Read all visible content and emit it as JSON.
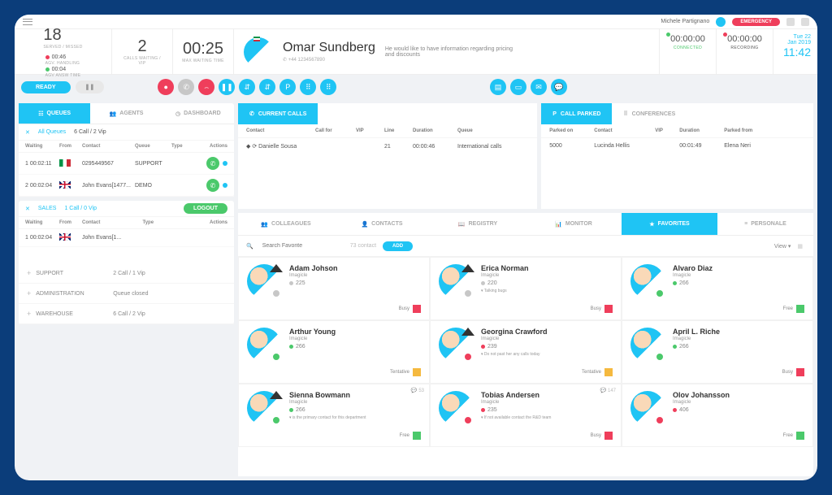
{
  "topbar": {
    "user": "Michele Partignano",
    "emergency": "EMERGENCY"
  },
  "stats": {
    "served": "18",
    "served_label": "SERVED / MISSED",
    "t1": "00:46",
    "t1l": "AGV. HANDLING",
    "t2": "00:04",
    "t2l": "AGV ANSW TIME",
    "calls": "2",
    "calls_label": "CALLS WAITING / VIP",
    "maxwait": "00:25",
    "maxwait_label": "MAX WAITING TIME"
  },
  "caller": {
    "name": "Omar Sundberg",
    "phone": "+44 1234567890",
    "desc": "He would like to have information regarding pricing and discounts"
  },
  "timers": {
    "connected": "00:00:00",
    "connected_l": "CONNECTED",
    "recording": "00:00:00",
    "recording_l": "RECORDING"
  },
  "date": {
    "day": "Tue 22",
    "month": "Jan 2019",
    "time": "11:42"
  },
  "ready": "READY",
  "ltabs": [
    "QUEUES",
    "AGENTS",
    "DASHBOARD"
  ],
  "allq": "All Queues",
  "qstat": "6 Call / 2 Vip",
  "qh": {
    "w": "Waiting",
    "f": "From",
    "c": "Contact",
    "q": "Queue",
    "t": "Type",
    "a": "Actions"
  },
  "qrows": [
    {
      "i": "1",
      "w": "00:02:11",
      "flag": "it",
      "c": "0295449567",
      "q": "SUPPORT"
    },
    {
      "i": "2",
      "w": "00:02:04",
      "flag": "uk",
      "c": "John Evans[1477...",
      "q": "DEMO"
    }
  ],
  "sales": {
    "name": "SALES",
    "stat": "1 Call / 0 Vip",
    "logout": "LOGOUT"
  },
  "sh": {
    "w": "Waiting",
    "f": "From",
    "c": "Contact",
    "t": "Type",
    "a": "Actions"
  },
  "srows": [
    {
      "i": "1",
      "w": "00:02:04",
      "flag": "uk",
      "c": "John Evans[1..."
    }
  ],
  "queues": [
    {
      "n": "SUPPORT",
      "s": "2 Call / 1 Vip"
    },
    {
      "n": "ADMINISTRATION",
      "s": "Queue closed"
    },
    {
      "n": "WAREHOUSE",
      "s": "6 Call / 2 Vip"
    }
  ],
  "cc": {
    "title": "CURRENT CALLS",
    "h": {
      "c": "Contact",
      "cf": "Call for",
      "v": "VIP",
      "l": "Line",
      "d": "Duration",
      "q": "Queue"
    },
    "r": {
      "c": "Danielle Sousa",
      "l": "21",
      "d": "00:00:46",
      "q": "International calls"
    }
  },
  "cp": {
    "title": "CALL PARKED",
    "alt": "CONFERENCES",
    "h": {
      "p": "Parked on",
      "c": "Contact",
      "v": "VIP",
      "d": "Duration",
      "pf": "Parked from"
    },
    "r": {
      "p": "5000",
      "c": "Lucinda Hellis",
      "d": "00:01:49",
      "pf": "Elena Neri"
    }
  },
  "btabs": [
    "COLLEAGUES",
    "CONTACTS",
    "REGISTRY",
    "MONITOR",
    "FAVORITES",
    "PERSONALE"
  ],
  "search": {
    "ph": "Search Favorite",
    "count": "73 contact",
    "add": "ADD",
    "view": "View"
  },
  "cards": [
    {
      "n": "Adam Johson",
      "co": "Imagicle",
      "ext": "225",
      "dot": "gray",
      "st": "Busy",
      "sq": "#ef3e5b",
      "tri": "#333"
    },
    {
      "n": "Erica Norman",
      "co": "Imagicle",
      "ext": "220",
      "dot": "gray",
      "note": "▾ Talking bugs",
      "st": "Busy",
      "sq": "#ef3e5b",
      "tri": "#333"
    },
    {
      "n": "Alvaro Diaz",
      "co": "Imagicle",
      "ext": "266",
      "dot": "green",
      "st": "Free",
      "sq": "#4bc96b"
    },
    {
      "n": "Arthur Young",
      "co": "Imagicle",
      "ext": "266",
      "dot": "green",
      "st": "Tentative",
      "sq": "#f5b93f"
    },
    {
      "n": "Georgina Crawford",
      "co": "Imagicle",
      "ext": "239",
      "dot": "red",
      "note": "▾ Do not past her any calls today",
      "st": "Tentative",
      "sq": "#f5b93f",
      "tri": "#333"
    },
    {
      "n": "April L. Riche",
      "co": "Imagicle",
      "ext": "266",
      "dot": "green",
      "st": "Busy",
      "sq": "#ef3e5b"
    },
    {
      "n": "Sienna Bowmann",
      "co": "Imagicle",
      "ext": "266",
      "dot": "green",
      "note": "▾ is the primary contact for this department",
      "st": "Free",
      "sq": "#4bc96b",
      "tri": "#333",
      "corner": "53"
    },
    {
      "n": "Tobias Andersen",
      "co": "Imagicle",
      "ext": "235",
      "dot": "red",
      "note": "▾ If not available contact the R&D team",
      "st": "Busy",
      "sq": "#ef3e5b",
      "corner": "147"
    },
    {
      "n": "Olov Johansson",
      "co": "Imagicle",
      "ext": "406",
      "dot": "red",
      "st": "Free",
      "sq": "#4bc96b"
    }
  ]
}
